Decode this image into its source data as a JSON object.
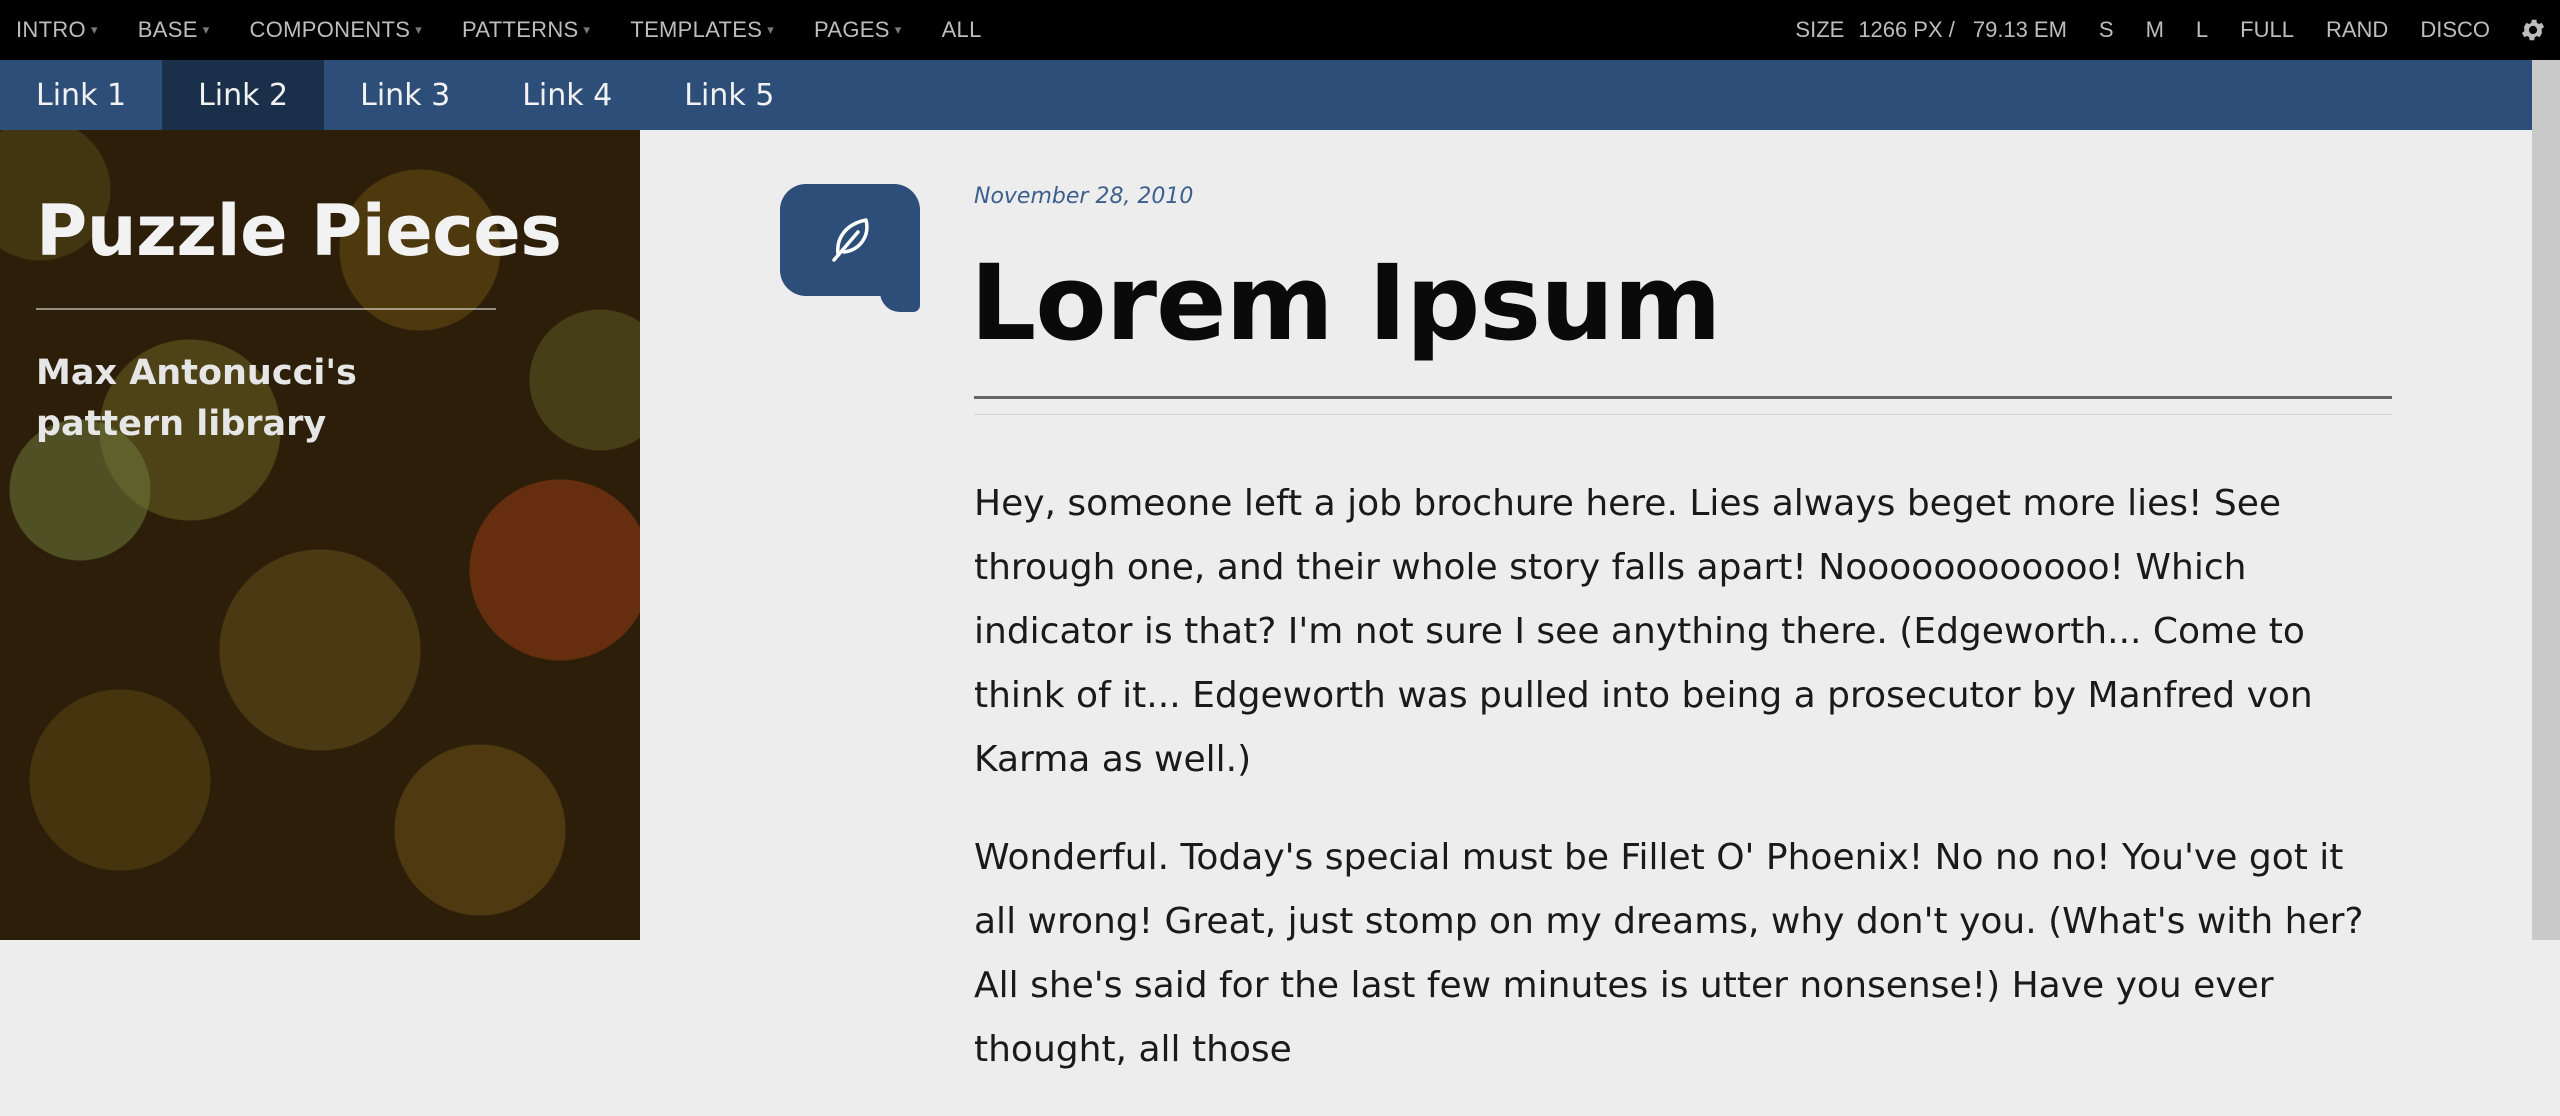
{
  "toolbar": {
    "menus": [
      {
        "label": "INTRO",
        "has_caret": true
      },
      {
        "label": "BASE",
        "has_caret": true
      },
      {
        "label": "COMPONENTS",
        "has_caret": true
      },
      {
        "label": "PATTERNS",
        "has_caret": true
      },
      {
        "label": "TEMPLATES",
        "has_caret": true
      },
      {
        "label": "PAGES",
        "has_caret": true
      },
      {
        "label": "ALL",
        "has_caret": false
      }
    ],
    "caret": "▾",
    "size_label": "SIZE",
    "size_px": "1266",
    "size_px_unit": "PX /",
    "size_em": "79.13",
    "size_em_unit": "EM",
    "size_buttons": [
      "S",
      "M",
      "L",
      "FULL",
      "RAND",
      "DISCO"
    ],
    "settings_icon": "gear-icon"
  },
  "nav": {
    "links": [
      "Link 1",
      "Link 2",
      "Link 3",
      "Link 4",
      "Link 5"
    ],
    "active_index": 1
  },
  "sidebar": {
    "title": "Puzzle Pieces",
    "tagline": "Max Antonucci's pattern library"
  },
  "post": {
    "icon": "feather-icon",
    "date": "November 28, 2010",
    "title": "Lorem Ipsum",
    "paragraphs": [
      "Hey, someone left a job brochure here. Lies always beget more lies! See through one, and their whole story falls apart! Noooooooooooo! Which indicator is that? I'm not sure I see anything there. (Edgeworth... Come to think of it... Edgeworth was pulled into being a prosecutor by Manfred von Karma as well.)",
      "Wonderful. Today's special must be Fillet O' Phoenix! No no no! You've got it all wrong! Great, just stomp on my dreams, why don't you. (What's with her? All she's said for the last few minutes is utter nonsense!) Have you ever thought, all those"
    ]
  },
  "colors": {
    "toolbar_bg": "#000000",
    "nav_bg": "#2c4e78",
    "nav_active_bg": "#1a2f4a",
    "accent": "#2c4e78",
    "content_bg": "#ededed"
  }
}
